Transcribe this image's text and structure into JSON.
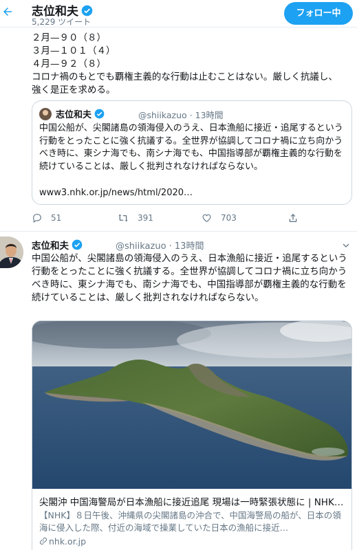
{
  "header": {
    "name": "志位和夫",
    "tweet_count": "5,229 ツイート",
    "follow_button": "フォロー中"
  },
  "tweet1": {
    "lines": [
      "２月—９０（８）",
      "３月—１０１（４）",
      "４月—９２（８）",
      "コロナ禍のもとでも覇権主義的な行動は止むことはない。厳しく抗議し、",
      "強く是正を求める。"
    ],
    "quote": {
      "name": "志位和夫",
      "handle": "@shiikazuo · 13時間",
      "text": "中国公船が、尖閣諸島の領海侵入のうえ、日本漁船に接近・追尾するという行動をとったことに強く抗議する。全世界が協調してコロナ禍に立ち向かうべき時に、東シナ海でも、南シナ海でも、中国指導部が覇権主義的な行動を続けていることは、厳しく批判されなければならない。",
      "link": "www3.nhk.or.jp/news/html/2020…"
    },
    "actions": {
      "replies": "51",
      "retweets": "391",
      "likes": "703"
    }
  },
  "tweet2": {
    "name": "志位和夫",
    "handle": "@shiikazuo · 13時間",
    "text": "中国公船が、尖閣諸島の領海侵入のうえ、日本漁船に接近・追尾するという行動をとったことに強く抗議する。全世界が協調してコロナ禍に立ち向かうべき時に、東シナ海でも、南シナ海でも、中国指導部が覇権主義的な行動を続けていることは、厳しく批判されなければならない。",
    "card": {
      "title": "尖閣沖 中国海警局が日本漁船に接近追尾 現場は一時緊張状態に | NHK…",
      "description": "【NHK】８日午後、沖縄県の尖閣諸島の沖合で、中国海警局の船が、日本の領海に侵入した際、付近の海域で操業していた日本の漁船に接近…",
      "domain": "nhk.or.jp"
    }
  },
  "colors": {
    "accent": "#1da1f2",
    "secondary_text": "#657786",
    "border": "#ccd6dd"
  },
  "icons": [
    "back-arrow-icon",
    "verified-badge-icon",
    "reply-icon",
    "retweet-icon",
    "like-icon",
    "share-icon",
    "chevron-down-icon",
    "link-icon"
  ]
}
